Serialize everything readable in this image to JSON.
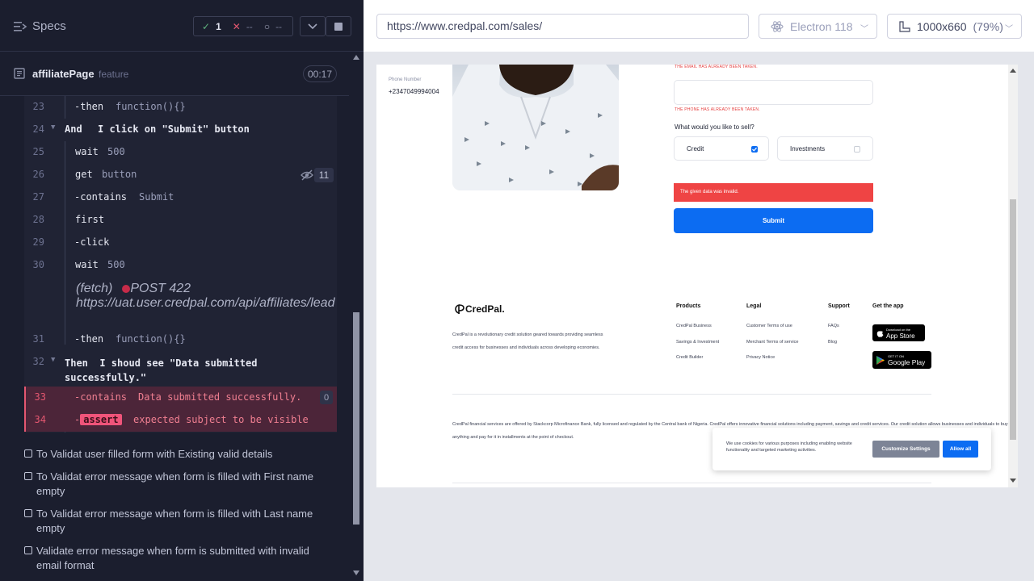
{
  "reporter": {
    "title": "Specs",
    "stats": {
      "passed": "1",
      "failed": "--",
      "pending": "--"
    },
    "spec_file": {
      "name": "affiliatePage",
      "ext": "feature",
      "duration": "00:17"
    },
    "commands": [
      {
        "ln": "23",
        "name": "-then",
        "arg": "function(){}"
      },
      {
        "ln": "24",
        "step": "And",
        "text": "I click on \"Submit\" button"
      },
      {
        "ln": "25",
        "name": "wait",
        "arg": "500"
      },
      {
        "ln": "26",
        "name": "get",
        "arg": "button",
        "count": "11"
      },
      {
        "ln": "27",
        "name": "-contains",
        "arg": "Submit"
      },
      {
        "ln": "28",
        "name": "first",
        "arg": ""
      },
      {
        "ln": "29",
        "name": "-click",
        "arg": ""
      },
      {
        "ln": "30",
        "name": "wait",
        "arg": "500"
      },
      {
        "fetch_label": "(fetch)",
        "fetch_method": "POST 422",
        "fetch_url": "https://uat.user.credpal.com/api/affiliates/lead"
      },
      {
        "ln": "31",
        "name": "-then",
        "arg": "function(){}"
      },
      {
        "ln": "32",
        "step": "Then",
        "text": "I shoud see \"Data submitted successfully.\""
      },
      {
        "ln": "33",
        "name": "-contains",
        "arg": "Data submitted successfully.",
        "count": "0"
      },
      {
        "ln": "34",
        "dash": "-",
        "chip": "assert",
        "words": "expected subject to be visible"
      }
    ],
    "tests": [
      "To Validat user filled form with Existing valid details",
      "To Validat error message when form is filled with First name empty",
      "To Validat error message when form is filled with Last name empty",
      "Validate error message when form is submitted with invalid email format"
    ]
  },
  "aut": {
    "url": "https://www.credpal.com/sales/",
    "browser": "Electron 118",
    "viewport": "1000x660",
    "zoom": "(79%)",
    "form": {
      "email_error": "THE EMAIL HAS ALREADY BEEN TAKEN.",
      "phone_label": "Phone Number",
      "phone_value": "+2347049994004",
      "phone_error": "THE PHONE HAS ALREADY BEEN TAKEN.",
      "sell_question": "What would you like to sell?",
      "option_credit": "Credit",
      "option_investments": "Investments",
      "error_banner": "The given data was invalid.",
      "submit": "Submit"
    },
    "footer": {
      "logo": "CredPal.",
      "description": "CredPal is a revolutionary credit solution geared towards providing seamless credit access for businesses and individuals across developing economies.",
      "cols": [
        {
          "title": "Products",
          "links": [
            "CredPal Business",
            "Savings & Investment",
            "Credit Builder"
          ]
        },
        {
          "title": "Legal",
          "links": [
            "Customer Terms of use",
            "Merchant Terms of service",
            "Privacy Notice"
          ]
        },
        {
          "title": "Support",
          "links": [
            "FAQs",
            "Blog"
          ]
        }
      ],
      "get_app": "Get the app",
      "app_store_small": "Download on the",
      "app_store": "App Store",
      "google_play_small": "GET IT ON",
      "google_play": "Google Play",
      "legal": "CredPal financial services are offered by Stackcorp Microfinance Bank, fully licensed and regulated by the Central bank of Nigeria. CredPal offers innovative financial solutions including payment, savings and credit services. Our credit solution allows businesses and individuals to buy anything and pay for it in installments at the point of checkout."
    },
    "cookie": {
      "text": "We use cookies for various purposes including enabling website functionality and targeted marketing activities.",
      "customize": "Customize Settings",
      "allow": "Allow all"
    }
  }
}
